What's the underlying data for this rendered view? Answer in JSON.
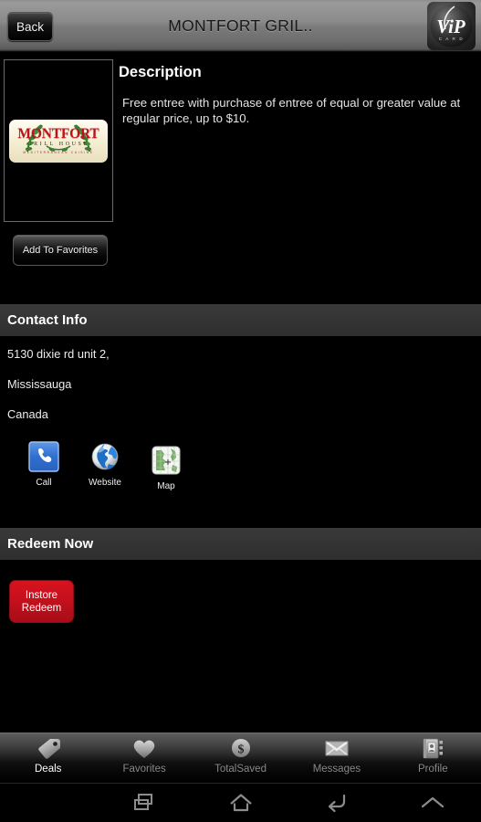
{
  "titlebar": {
    "back_label": "Back",
    "title": "MONTFORT GRIL..",
    "logo_icon": "vip-card-logo",
    "logo_text_main": "ViP",
    "logo_text_sub": "C A R D"
  },
  "merchant_logo": {
    "icon": "montfort-grill-house-logo",
    "name": "MONTFORT",
    "subtitle": "GRILL     HOUSE",
    "tagline": "MEDITERRANEAN  CUISINE",
    "colors": {
      "text": "#c1121a",
      "background": "#f6f0d8",
      "laurel": "#2f6b2a"
    }
  },
  "description": {
    "heading": "Description",
    "body": "Free entree with purchase of entree of equal or greater value at regular price, up to $10."
  },
  "favorites": {
    "button_label": "Add To Favorites"
  },
  "contact": {
    "heading": "Contact Info",
    "address_lines": [
      "5130 dixie rd unit 2,",
      "Mississauga",
      "Canada"
    ],
    "actions": [
      {
        "label": "Call",
        "icon": "phone-icon"
      },
      {
        "label": "Website",
        "icon": "globe-icon"
      },
      {
        "label": "Map",
        "icon": "map-icon"
      }
    ]
  },
  "redeem": {
    "heading": "Redeem Now",
    "button_label_line1": "Instore",
    "button_label_line2": "Redeem",
    "button_color": "#c5101c"
  },
  "tabbar": {
    "tabs": [
      {
        "label": "Deals",
        "icon": "tag-icon",
        "active": true
      },
      {
        "label": "Favorites",
        "icon": "heart-icon",
        "active": false
      },
      {
        "label": "TotalSaved",
        "icon": "dollar-circle-icon",
        "active": false
      },
      {
        "label": "Messages",
        "icon": "envelope-icon",
        "active": false
      },
      {
        "label": "Profile",
        "icon": "contact-book-icon",
        "active": false
      }
    ]
  },
  "navbar": {
    "buttons": [
      {
        "name": "recents",
        "icon": "recents-icon"
      },
      {
        "name": "home",
        "icon": "home-icon"
      },
      {
        "name": "back",
        "icon": "back-arrow-icon"
      },
      {
        "name": "expand",
        "icon": "chevron-up-icon"
      }
    ]
  }
}
